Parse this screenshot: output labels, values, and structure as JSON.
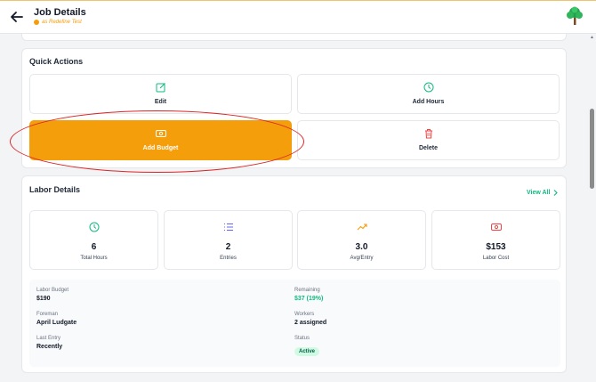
{
  "header": {
    "title": "Job Details",
    "subtitle": "as Redefine Test"
  },
  "quick_actions": {
    "title": "Quick Actions",
    "buttons": [
      {
        "label": "Edit",
        "icon": "edit-icon"
      },
      {
        "label": "Add Hours",
        "icon": "clock-icon"
      },
      {
        "label": "Add Budget",
        "icon": "money-icon"
      },
      {
        "label": "Delete",
        "icon": "trash-icon"
      }
    ]
  },
  "labor": {
    "title": "Labor Details",
    "view_all": "View All",
    "stats": [
      {
        "value": "6",
        "label": "Total Hours",
        "icon": "clock-icon"
      },
      {
        "value": "2",
        "label": "Entries",
        "icon": "list-icon"
      },
      {
        "value": "3.0",
        "label": "Avg/Entry",
        "icon": "trend-up-icon"
      },
      {
        "value": "$153",
        "label": "Labor Cost",
        "icon": "money-icon"
      }
    ],
    "details": {
      "labor_budget_label": "Labor Budget",
      "labor_budget_value": "$190",
      "remaining_label": "Remaining",
      "remaining_value": "$37 (19%)",
      "foreman_label": "Foreman",
      "foreman_value": "April Ludgate",
      "workers_label": "Workers",
      "workers_value": "2 assigned",
      "last_entry_label": "Last Entry",
      "last_entry_value": "Recently",
      "status_label": "Status",
      "status_value": "Active"
    }
  },
  "colors": {
    "accent": "#f59e0b",
    "green": "#10b981",
    "danger": "#ef4444",
    "highlight": "#dc2626"
  }
}
